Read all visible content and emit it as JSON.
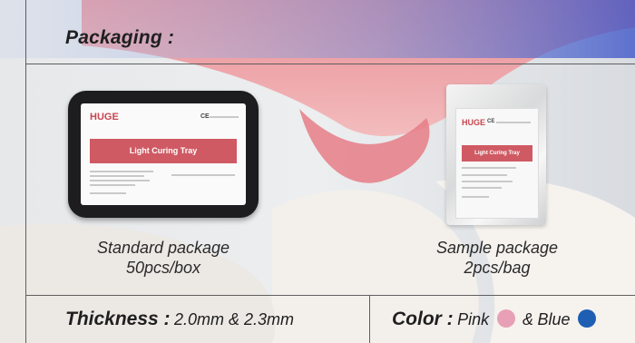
{
  "packaging": {
    "heading": "Packaging :",
    "standard": {
      "title": "Standard package",
      "quantity": "50pcs/box",
      "label_brand": "HUGE",
      "label_ce": "CE",
      "label_product": "Light Curing Tray"
    },
    "sample": {
      "title": "Sample package",
      "quantity": "2pcs/bag",
      "label_brand": "HUGE",
      "label_ce": "CE",
      "label_product": "Light Curing Tray"
    }
  },
  "thickness": {
    "label": "Thickness :",
    "value": "2.0mm & 2.3mm"
  },
  "color": {
    "label": "Color :",
    "option_1": "Pink",
    "connector": "&",
    "option_2": "Blue",
    "pink_hex": "#e8a0b6",
    "blue_hex": "#1e5fb3"
  }
}
